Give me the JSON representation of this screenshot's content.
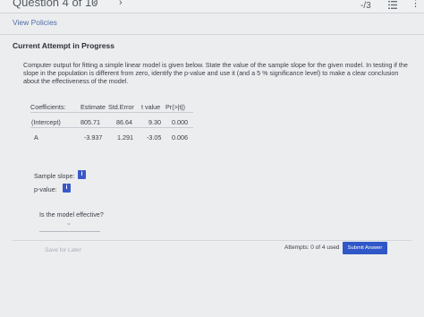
{
  "header": {
    "question_label": "Question 4 of 10",
    "prev_icon": "chevron-left",
    "next_icon": "chevron-right",
    "score": "-/3",
    "list_icon": "list",
    "more_icon": "vertical-ellipsis"
  },
  "links": {
    "view_policies": "View Policies"
  },
  "section": {
    "title": "Current Attempt in Progress"
  },
  "question": {
    "text_1": "Computer output for fitting a simple linear model is given below. State the value of the sample slope for the given model. In testing if the slope in the population is different from zero, identify the p-value and use it (and a 5 % significance level) to make a clear conclusion about the effectiveness of the model."
  },
  "table": {
    "headers": [
      "Coefficients:",
      "Estimate",
      "Std.Error",
      "t value",
      "Pr(>|t|)"
    ],
    "rows": [
      [
        "(Intercept)",
        "805.71",
        "86.64",
        "9.30",
        "0.000"
      ],
      [
        "A",
        "-3.937",
        "1.291",
        "-3.05",
        "0.006"
      ]
    ]
  },
  "fields": {
    "slope_label": "Sample slope:",
    "pvalue_label": "p-value:",
    "info_glyph": "i",
    "effective_label": "Is the model effective?",
    "effective_chevron": "⌄"
  },
  "footer": {
    "save_later": "Save for Later",
    "attempts": "Attempts: 0 of 4 used",
    "submit": "Submit Answer"
  }
}
